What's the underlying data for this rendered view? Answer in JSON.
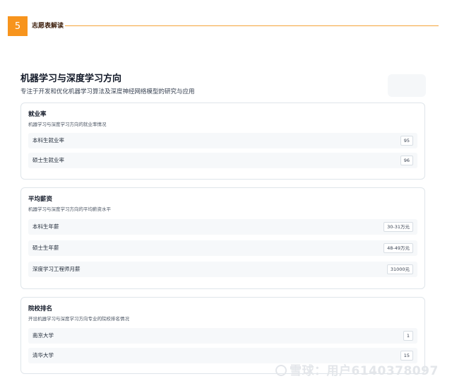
{
  "header": {
    "section_number": "5",
    "section_title": "志愿表解读"
  },
  "page": {
    "title": "机器学习与深度学习方向",
    "subtitle": "专注于开发和优化机器学习算法及深度神经网络模型的研究与应用"
  },
  "cards": [
    {
      "title": "就业率",
      "description": "机器学习与深度学习方向的就业率情况",
      "rows": [
        {
          "label": "本科生就业率",
          "value": "95"
        },
        {
          "label": "硕士生就业率",
          "value": "96"
        }
      ]
    },
    {
      "title": "平均薪资",
      "description": "机器学习与深度学习方向的平均薪资水平",
      "rows": [
        {
          "label": "本科生年薪",
          "value": "30-31万元"
        },
        {
          "label": "硕士生年薪",
          "value": "48-49万元"
        },
        {
          "label": "深度学习工程师月薪",
          "value": "31000元"
        }
      ]
    },
    {
      "title": "院校排名",
      "description": "开设机器学习与深度学习方向专业的院校排名情况",
      "rows": [
        {
          "label": "南京大学",
          "value": "1"
        },
        {
          "label": "清华大学",
          "value": "15"
        }
      ]
    }
  ],
  "watermark": {
    "text": "雪球：用户6140378097"
  }
}
